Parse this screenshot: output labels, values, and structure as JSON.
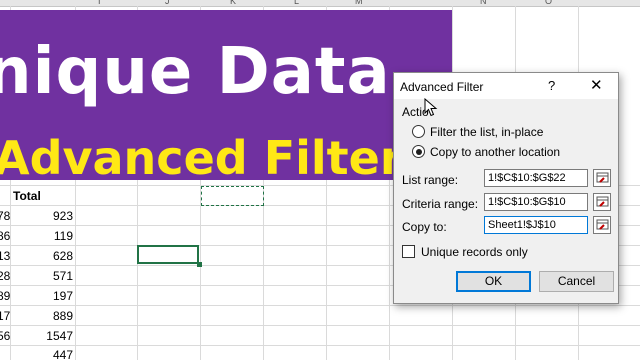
{
  "spreadsheet": {
    "column_letters": [
      "I",
      "J",
      "K",
      "L",
      "M",
      "N",
      "O"
    ],
    "header_total": "Total",
    "rows": [
      {
        "left": "78",
        "total": "923"
      },
      {
        "left": "86",
        "total": "119"
      },
      {
        "left": "13",
        "total": "628"
      },
      {
        "left": "28",
        "total": "571"
      },
      {
        "left": "89",
        "total": "197"
      },
      {
        "left": "17",
        "total": "889"
      },
      {
        "left": "56",
        "total": "1547"
      },
      {
        "left": "",
        "total": "447"
      }
    ]
  },
  "banner": {
    "title": "nique Data",
    "subtitle": "Advanced Filter",
    "bg_color": "#7031a0",
    "subtitle_color": "#ffe815"
  },
  "dialog": {
    "title": "Advanced Filter",
    "help": "?",
    "close": "✕",
    "action_label": "Actio",
    "radio_filter_in_place": "Filter the list, in-place",
    "radio_copy_to": "Copy to another location",
    "list_range_label": "List range:",
    "list_range_value": "1!$C$10:$G$22",
    "criteria_range_label": "Criteria range:",
    "criteria_range_value": "1!$C$10:$G$10",
    "copy_to_label": "Copy to:",
    "copy_to_value": "Sheet1!$J$10",
    "unique_records_label": "Unique records only",
    "ok_label": "OK",
    "cancel_label": "Cancel"
  }
}
